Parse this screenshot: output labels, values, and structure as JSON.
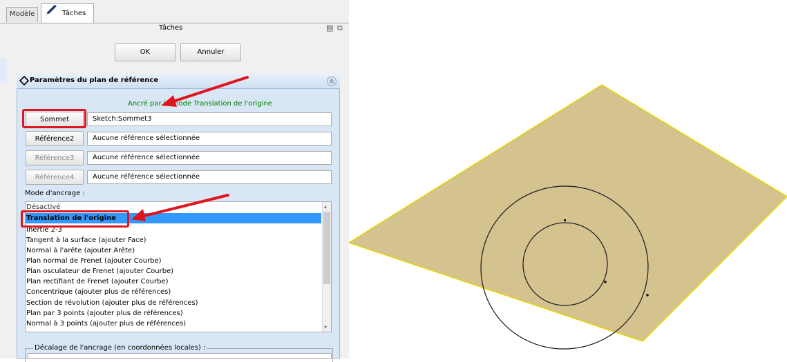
{
  "tabs": {
    "model": "Modèle",
    "tasks": "Tâches"
  },
  "panel": {
    "title": "Tâches"
  },
  "dialog": {
    "ok": "OK",
    "cancel": "Annuler"
  },
  "section": {
    "title": "Paramètres du plan de référence",
    "attached_status": "Ancré par le mode Translation de l'origine"
  },
  "references": [
    {
      "button": "Sommet",
      "value": "Sketch:Sommet3",
      "enabled": true
    },
    {
      "button": "Référence2",
      "value": "Aucune référence sélectionnée",
      "enabled": true
    },
    {
      "button": "Référence3",
      "value": "Aucune référence sélectionnée",
      "enabled": false
    },
    {
      "button": "Référence4",
      "value": "Aucune référence sélectionnée",
      "enabled": false
    }
  ],
  "attach_mode": {
    "label": "Mode d'ancrage :",
    "items": [
      "Désactivé",
      "Translation de l'origine",
      "Inertie 2-3",
      "Tangent à la surface (ajouter Face)",
      "Normal à l'arête (ajouter Arête)",
      "Plan normal de Frenet (ajouter Courbe)",
      "Plan osculateur de Frenet (ajouter Courbe)",
      "Plan rectifiant de Frenet (ajouter Courbe)",
      "Concentrique (ajouter plus de références)",
      "Section de révolution (ajouter plus de références)",
      "Plan par 3 points (ajouter plus de références)",
      "Normal à 3 points (ajouter plus de références)"
    ],
    "selected": "Translation de l'origine"
  },
  "offset": {
    "label": "Décalage de l'ancrage (en coordonnées locales) :"
  },
  "colors": {
    "plane": "#d4c28f",
    "plane_edge": "#e8d800",
    "accent": "#e0141c",
    "selection": "#3399ff"
  }
}
